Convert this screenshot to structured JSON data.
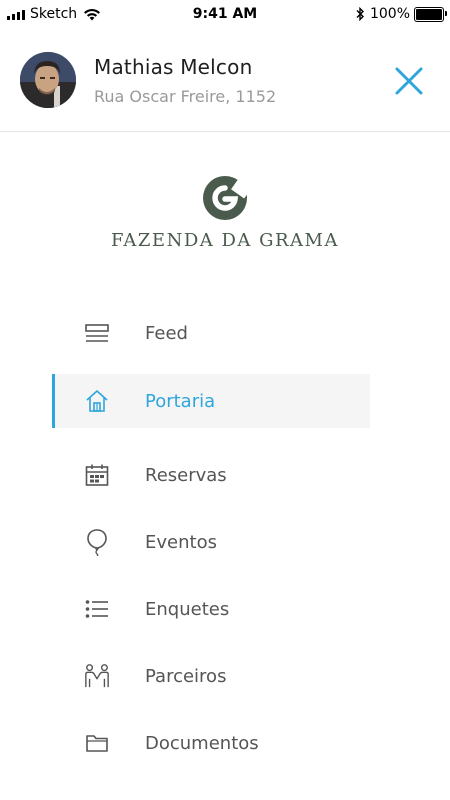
{
  "status_bar": {
    "carrier": "Sketch",
    "time": "9:41 AM",
    "battery_percent": "100%"
  },
  "header": {
    "user_name": "Mathias Melcon",
    "address": "Rua Oscar Freire, 1152",
    "close_icon": "close-icon"
  },
  "logo": {
    "mark_letter": "G",
    "text": "FAZENDA DA GRAMA",
    "color": "#4a5a4c"
  },
  "colors": {
    "accent": "#2ea6dc",
    "text": "#555555",
    "active_bg": "#f5f5f5"
  },
  "menu": {
    "items": [
      {
        "label": "Feed",
        "icon": "feed-icon",
        "active": false
      },
      {
        "label": "Portaria",
        "icon": "home-icon",
        "active": true
      },
      {
        "label": "Reservas",
        "icon": "calendar-icon",
        "active": false
      },
      {
        "label": "Eventos",
        "icon": "balloon-icon",
        "active": false
      },
      {
        "label": "Enquetes",
        "icon": "list-icon",
        "active": false
      },
      {
        "label": "Parceiros",
        "icon": "partners-icon",
        "active": false
      },
      {
        "label": "Documentos",
        "icon": "folder-icon",
        "active": false
      }
    ]
  }
}
